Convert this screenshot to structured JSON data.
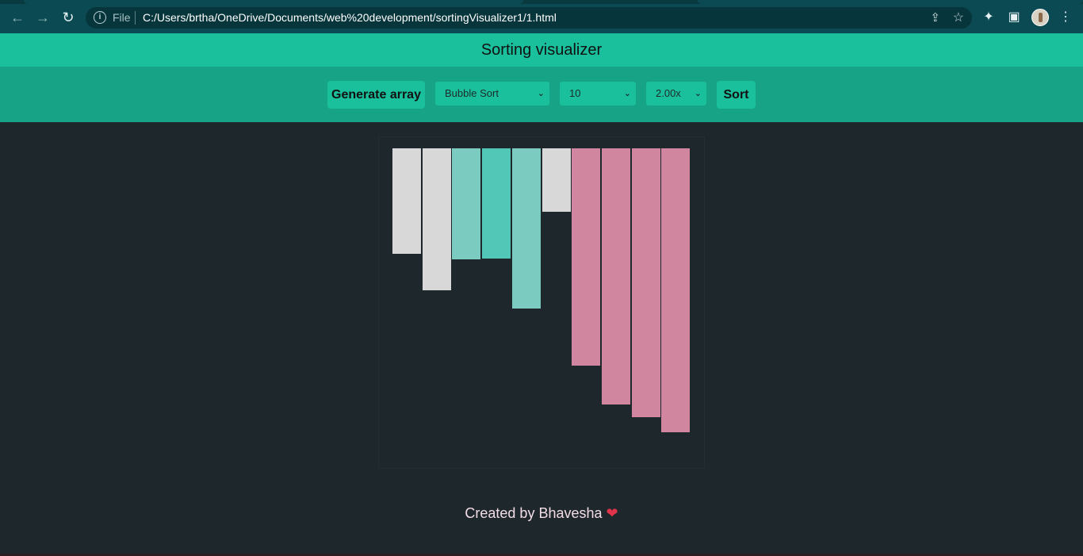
{
  "browser": {
    "file_label": "File",
    "url": "C:/Users/brtha/OneDrive/Documents/web%20development/sortingVisualizer1/1.html"
  },
  "header": {
    "title": "Sorting visualizer"
  },
  "controls": {
    "generate_label": "Generate array",
    "algorithm_value": "Bubble Sort",
    "size_value": "10",
    "speed_value": "2.00x",
    "sort_label": "Sort"
  },
  "array_bars": [
    {
      "value": 133,
      "state": "unsorted"
    },
    {
      "value": 179,
      "state": "unsorted"
    },
    {
      "value": 140,
      "state": "compare"
    },
    {
      "value": 139,
      "state": "compare-active"
    },
    {
      "value": 202,
      "state": "compare"
    },
    {
      "value": 80,
      "state": "unsorted"
    },
    {
      "value": 274,
      "state": "sorted"
    },
    {
      "value": 323,
      "state": "sorted"
    },
    {
      "value": 339,
      "state": "sorted"
    },
    {
      "value": 358,
      "state": "sorted"
    }
  ],
  "colors": {
    "unsorted": "#d8d8d8",
    "compare": "#7ccbc0",
    "compare-active": "#52c7b8",
    "sorted": "#d1869f"
  },
  "footer": {
    "text": "Created by Bhavesha",
    "heart": "❤"
  }
}
